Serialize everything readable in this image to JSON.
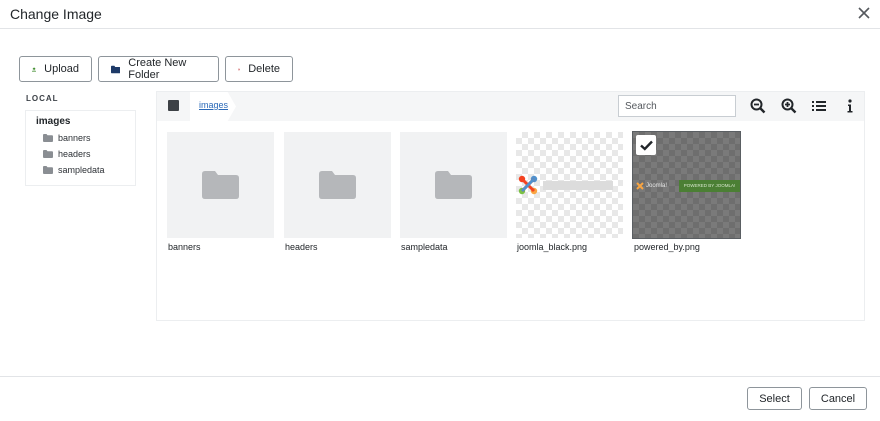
{
  "dialog": {
    "title": "Change Image"
  },
  "toolbar": {
    "upload_label": "Upload",
    "new_folder_label": "Create New Folder",
    "delete_label": "Delete"
  },
  "sidebar": {
    "section_label": "LOCAL",
    "root": "images",
    "items": [
      {
        "label": "banners"
      },
      {
        "label": "headers"
      },
      {
        "label": "sampledata"
      }
    ]
  },
  "browser": {
    "breadcrumb": "images",
    "search_placeholder": "Search",
    "items": [
      {
        "name": "banners",
        "type": "folder"
      },
      {
        "name": "headers",
        "type": "folder"
      },
      {
        "name": "sampledata",
        "type": "folder"
      },
      {
        "name": "joomla_black.png",
        "type": "image"
      },
      {
        "name": "powered_by.png",
        "type": "image",
        "selected": true
      }
    ],
    "powered_by_thumb": {
      "logo_text": "Joomla!",
      "badge_text": "POWERED BY JOOMLA!"
    }
  },
  "footer": {
    "select_label": "Select",
    "cancel_label": "Cancel"
  },
  "colors": {
    "upload_icon": "#3d8b2b",
    "folder_icon": "#1e3a68",
    "delete_icon": "#c0282a",
    "link": "#2a69b8"
  }
}
